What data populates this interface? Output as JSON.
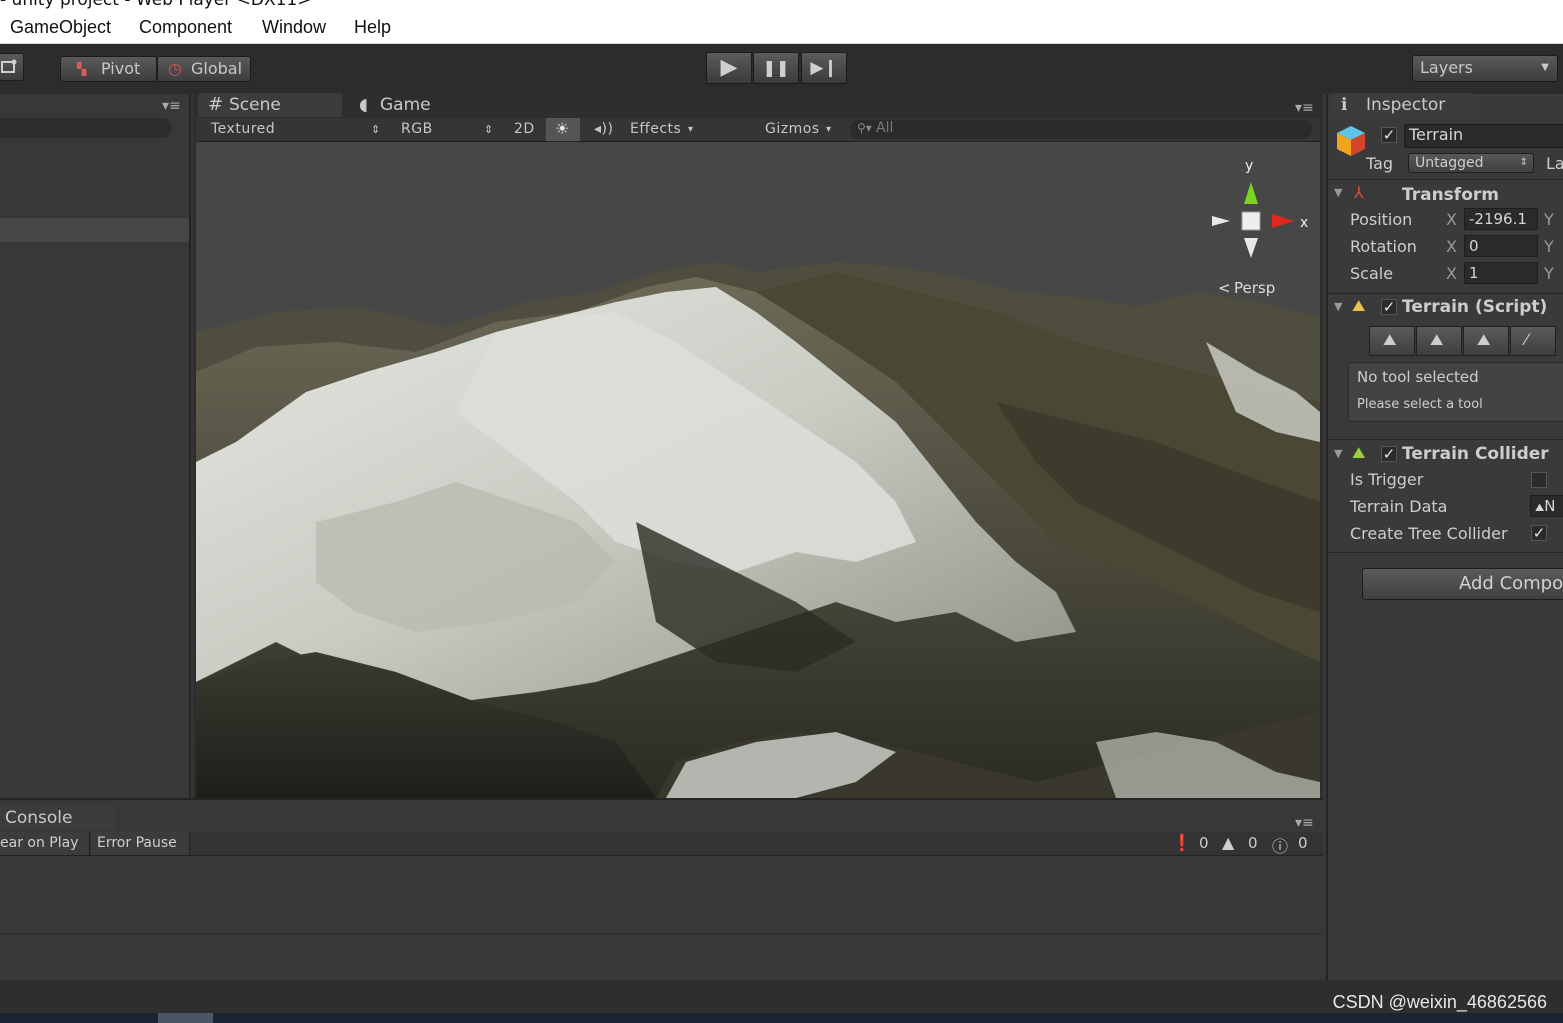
{
  "window": {
    "title": "- unity project - Web Player <DX11>"
  },
  "menu": {
    "items": [
      "GameObject",
      "Component",
      "Window",
      "Help"
    ]
  },
  "toolbar": {
    "pivot_label": "Pivot",
    "global_label": "Global",
    "play_glyph": "▶",
    "pause_glyph": "❚❚",
    "step_glyph": "▶❙",
    "layers_label": "Layers"
  },
  "scene": {
    "tab_scene": "Scene",
    "tab_game": "Game",
    "shading_mode": "Textured",
    "render_mode": "RGB",
    "toggle_2d": "2D",
    "effects_label": "Effects",
    "gizmos_label": "Gizmos",
    "search_placeholder": "All",
    "persp_label": "Persp",
    "axis_y": "y",
    "axis_x": "x"
  },
  "inspector": {
    "tab": "Inspector",
    "object_name": "Terrain",
    "tag_label": "Tag",
    "tag_value": "Untagged",
    "layer_label_partial": "La",
    "transform": {
      "title": "Transform",
      "position_label": "Position",
      "position_x": "-2196.1",
      "rotation_label": "Rotation",
      "rotation_x": "0",
      "scale_label": "Scale",
      "scale_x": "1",
      "x_axis": "X",
      "y_axis": "Y"
    },
    "terrain_script": {
      "title": "Terrain (Script)",
      "help_title": "No tool selected",
      "help_text": "Please select a tool"
    },
    "terrain_collider": {
      "title": "Terrain Collider",
      "is_trigger_label": "Is Trigger",
      "is_trigger": false,
      "terrain_data_label": "Terrain Data",
      "terrain_data_value": "N",
      "create_tree_label": "Create Tree Collider",
      "create_tree": true
    },
    "add_component_label": "Add Compo"
  },
  "console": {
    "tab": "Console",
    "clear_on_play": "ear on Play",
    "error_pause": "Error Pause",
    "count_errors": "0",
    "count_warnings": "0",
    "count_logs": "0"
  },
  "watermark": "CSDN @weixin_46862566",
  "colors": {
    "background": "#383838",
    "toolbar": "#2c2c2c",
    "gizmo_y": "#7ed321",
    "gizmo_x": "#e0281c"
  }
}
